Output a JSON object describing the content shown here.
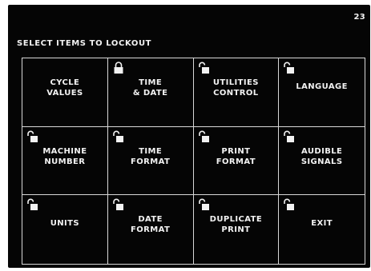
{
  "screen_number": "23",
  "title": "SELECT ITEMS TO LOCKOUT",
  "colors": {
    "background": "#050505",
    "foreground": "#f2f2f2",
    "grid": "#d8d8d8"
  },
  "items": [
    {
      "label": "CYCLE\nVALUES",
      "lock": "none"
    },
    {
      "label": "TIME\n& DATE",
      "lock": "locked-icon"
    },
    {
      "label": "UTILITIES\nCONTROL",
      "lock": "unlocked-icon"
    },
    {
      "label": "LANGUAGE",
      "lock": "unlocked-icon"
    },
    {
      "label": "MACHINE\nNUMBER",
      "lock": "unlocked-icon"
    },
    {
      "label": "TIME\nFORMAT",
      "lock": "unlocked-icon"
    },
    {
      "label": "PRINT\nFORMAT",
      "lock": "unlocked-icon"
    },
    {
      "label": "AUDIBLE\nSIGNALS",
      "lock": "unlocked-icon"
    },
    {
      "label": "UNITS",
      "lock": "unlocked-icon"
    },
    {
      "label": "DATE\nFORMAT",
      "lock": "unlocked-icon"
    },
    {
      "label": "DUPLICATE\nPRINT",
      "lock": "unlocked-icon"
    },
    {
      "label": "EXIT",
      "lock": "unlocked-icon"
    }
  ]
}
